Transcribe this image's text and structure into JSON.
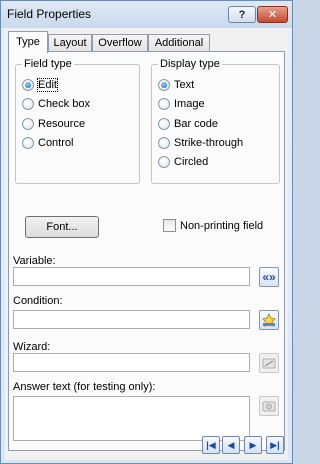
{
  "window": {
    "title": "Field Properties"
  },
  "titlebar": {
    "help_label": "?",
    "close_label": "✕"
  },
  "tabs": [
    {
      "label": "Type"
    },
    {
      "label": "Layout"
    },
    {
      "label": "Overflow"
    },
    {
      "label": "Additional"
    }
  ],
  "field_type": {
    "title": "Field type",
    "options": [
      {
        "label": "Edit",
        "selected": true
      },
      {
        "label": "Check box",
        "selected": false
      },
      {
        "label": "Resource",
        "selected": false
      },
      {
        "label": "Control",
        "selected": false
      }
    ]
  },
  "display_type": {
    "title": "Display type",
    "options": [
      {
        "label": "Text",
        "selected": true
      },
      {
        "label": "Image",
        "selected": false
      },
      {
        "label": "Bar code",
        "selected": false
      },
      {
        "label": "Strike-through",
        "selected": false
      },
      {
        "label": "Circled",
        "selected": false
      }
    ]
  },
  "font_button": {
    "label": "Font..."
  },
  "non_printing": {
    "label": "Non-printing field",
    "checked": false
  },
  "variable": {
    "label": "Variable:",
    "value": "",
    "button_label": "«»"
  },
  "condition": {
    "label": "Condition:",
    "value": ""
  },
  "wizard": {
    "label": "Wizard:",
    "value": ""
  },
  "answer_text": {
    "label": "Answer text (for testing only):",
    "value": ""
  },
  "navigation": {
    "first": "|◀",
    "prev": "◀",
    "next": "▶",
    "last": "▶|"
  }
}
